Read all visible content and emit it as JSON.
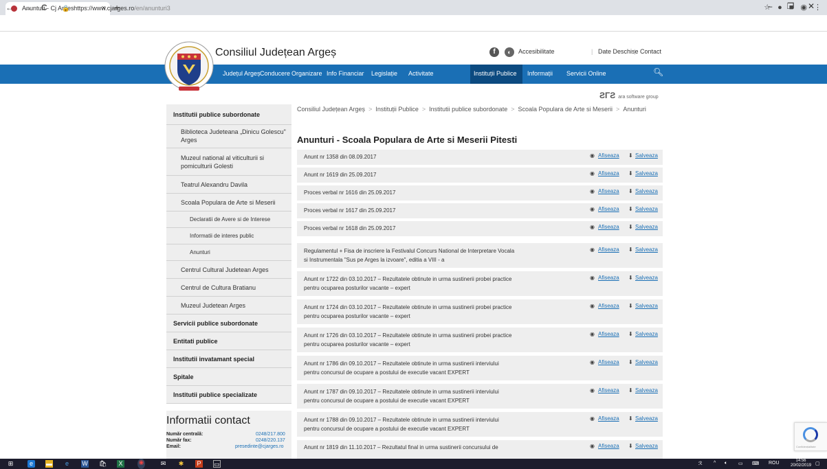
{
  "browser": {
    "tab_title": "Anunturi - Cj Arges",
    "tab_close": "×",
    "new_tab": "+",
    "url_scheme": "https://www.cjarges.ro",
    "url_path": "/en/anunturi3",
    "win_min": "–",
    "win_max": "❐",
    "win_close": "✕",
    "back": "←",
    "forward": "→",
    "reload": "C"
  },
  "header": {
    "site_title": "Consiliul Județean Argeș",
    "facebook": "f",
    "accessibility_label": "Accesibilitate",
    "open_data_label": "Date Deschise",
    "contact_label": "Contact",
    "sep": "|"
  },
  "nav": {
    "items": [
      "Județul Argeș",
      "Conducere",
      "Organizare",
      "Info Financiar",
      "Legislație",
      "Activitate",
      "Instituții Publice",
      "Informații",
      "Servicii Online"
    ]
  },
  "partner": {
    "mark": "ƧΓƧ",
    "label": "ara software group"
  },
  "sidebar": {
    "items": [
      {
        "label": "Institutii publice subordonate"
      },
      {
        "label": "Biblioteca Judeteana „Dinicu Golescu\" Arges"
      },
      {
        "label": "Muzeul national al viticulturii si pomiculturii Golesti"
      },
      {
        "label": "Teatrul Alexandru Davila"
      },
      {
        "label": "Scoala Populara de Arte si Meserii"
      },
      {
        "label": "Declaratii de Avere si de Interese"
      },
      {
        "label": "Informatii de interes public"
      },
      {
        "label": "Anunturi"
      },
      {
        "label": "Centrul Cultural Judetean Arges"
      },
      {
        "label": "Centrul de Cultura Bratianu"
      },
      {
        "label": "Muzeul Judetean Arges"
      },
      {
        "label": "Servicii publice subordonate"
      },
      {
        "label": "Entitati publice"
      },
      {
        "label": "Institutii invatamant special"
      },
      {
        "label": "Spitale"
      },
      {
        "label": "Institutii publice specializate"
      }
    ]
  },
  "contact": {
    "title": "Informatii contact",
    "central_label": "Număr centrală:",
    "central_value": "0248/217.800",
    "fax_label": "Număr fax:",
    "fax_value": "0248/220.137",
    "email_label": "Email:",
    "email_value": "presedinte@cjarges.ro"
  },
  "breadcrumb": [
    "Consiliul Județean Argeș",
    "Instituții Publice",
    "Institutii publice subordonate",
    "Scoala Populara de Arte si Meserii",
    "Anunturi"
  ],
  "breadcrumb_sep": ">",
  "page_title": "Anunturi - Scoala Populara de Arte si Meserii Pitesti",
  "actions": {
    "view_icon": "◉",
    "view_label": "Afiseaza",
    "save_icon": "⬇",
    "save_label": "Salveaza"
  },
  "announcements": [
    {
      "line1": "Anunt nr 1358 din 08.09.2017",
      "line2": ""
    },
    {
      "line1": "Anunt nr 1619 din 25.09.2017",
      "line2": ""
    },
    {
      "line1": "Proces verbal nr 1616 din 25.09.2017",
      "line2": ""
    },
    {
      "line1": "Proces verbal nr 1617 din 25.09.2017",
      "line2": ""
    },
    {
      "line1": "Proces verbal nr 1618 din 25.09.2017",
      "line2": ""
    },
    {
      "line1": "Regulamentul + Fisa de inscriere la Festivalul Concurs National de Interpretare Vocala",
      "line2": "si Instrumentala \"Sus pe Arges la izvoare\", editia a VIII - a"
    },
    {
      "line1": "Anunt nr 1722 din 03.10.2017 – Rezultatele obtinute in urma sustinerii probei practice",
      "line2": "pentru ocuparea posturilor vacante – expert"
    },
    {
      "line1": "Anunt nr 1724 din 03.10.2017 – Rezultatele obtinute in urma sustinerii probei practice",
      "line2": "pentru ocuparea posturilor vacante – expert"
    },
    {
      "line1": "Anunt nr 1726 din 03.10.2017 – Rezultatele obtinute in urma sustinerii probei practice",
      "line2": "pentru ocuparea posturilor vacante – expert"
    },
    {
      "line1": "Anunt nr 1786 din 09.10.2017 – Rezultatele obtinute in urma sustinerii interviului",
      "line2": "pentru concursul de ocupare a postului de executie vacant EXPERT"
    },
    {
      "line1": "Anunt nr 1787 din 09.10.2017 – Rezultatele obtinute in urma sustinerii interviului",
      "line2": "pentru concursul de ocupare a postului de executie vacant EXPERT"
    },
    {
      "line1": "Anunt nr 1788 din 09.10.2017 – Rezultatele obtinute in urma sustinerii interviului",
      "line2": "pentru concursul de ocupare a postului de executie vacant EXPERT"
    },
    {
      "line1": "Anunt nr 1819 din 11.10.2017 – Rezultatul final in urma sustinerii concursului de",
      "line2": ""
    }
  ],
  "taskbar": {
    "lang": "ROU",
    "time": "14:56",
    "date": "20/02/2019"
  },
  "colors": {
    "brand_blue": "#1a6fb5",
    "nav_active": "#0c4a80",
    "row_bg": "#eeeeee"
  }
}
